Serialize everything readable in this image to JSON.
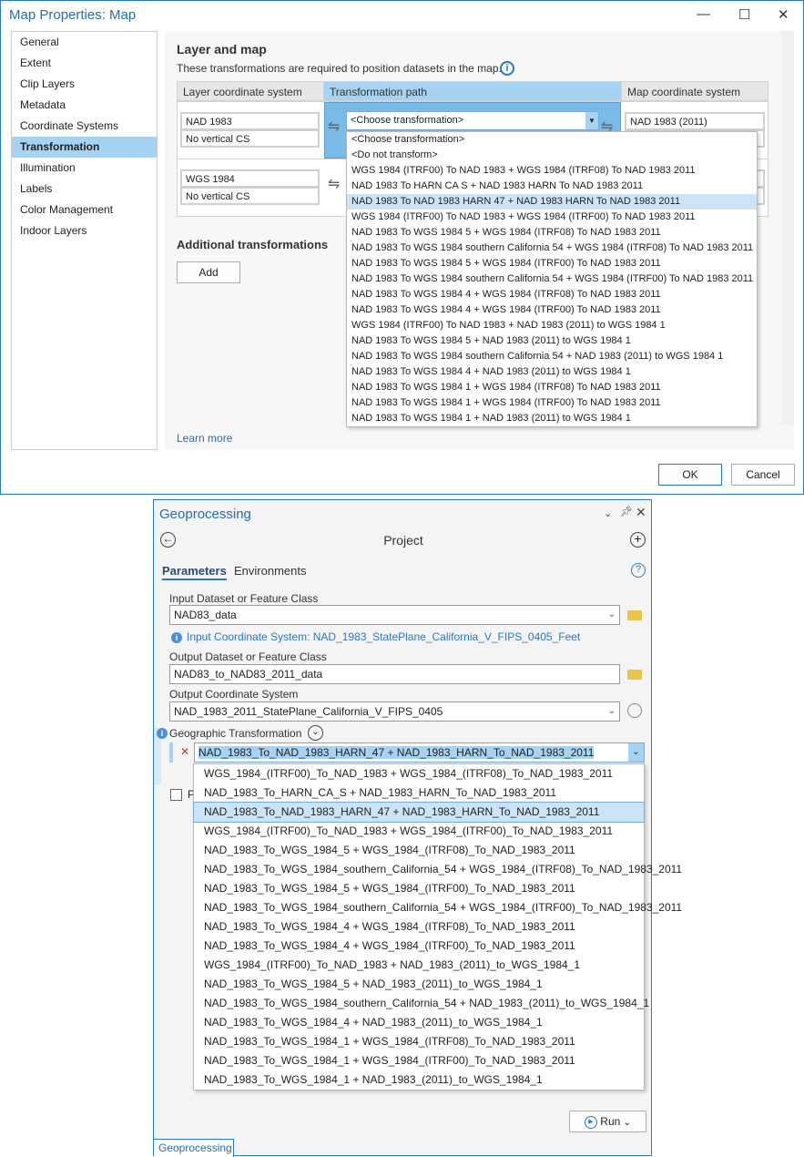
{
  "map_window": {
    "title": "Map Properties: Map",
    "controls": {
      "minimize": "—",
      "maximize": "☐",
      "close": "✕"
    },
    "sidebar": [
      "General",
      "Extent",
      "Clip Layers",
      "Metadata",
      "Coordinate Systems",
      "Transformation",
      "Illumination",
      "Labels",
      "Color Management",
      "Indoor Layers"
    ],
    "selected_sidebar": "Transformation",
    "section_title": "Layer and map",
    "description": "These transformations are required to position datasets in the map.",
    "columns": [
      "Layer coordinate system",
      "Transformation path",
      "Map coordinate system"
    ],
    "rows": [
      {
        "layer_cs": "NAD 1983",
        "layer_vcs": "No vertical CS",
        "transformation": "<Choose transformation>",
        "map_cs": "NAD 1983 (2011)"
      },
      {
        "layer_cs": "WGS 1984",
        "layer_vcs": "No vertical CS"
      }
    ],
    "dropdown_options": [
      "<Choose transformation>",
      "<Do not transform>",
      "WGS 1984 (ITRF00) To NAD 1983 + WGS 1984 (ITRF08) To NAD 1983 2011",
      "NAD 1983 To HARN CA S + NAD 1983 HARN To NAD 1983 2011",
      "NAD 1983 To NAD 1983 HARN 47 + NAD 1983 HARN To NAD 1983 2011",
      "WGS 1984 (ITRF00) To NAD 1983 + WGS 1984 (ITRF00) To NAD 1983 2011",
      "NAD 1983 To WGS 1984 5 + WGS 1984 (ITRF08) To NAD 1983 2011",
      "NAD 1983 To WGS 1984 southern California 54 + WGS 1984 (ITRF08) To NAD 1983 2011",
      "NAD 1983 To WGS 1984 5 + WGS 1984 (ITRF00) To NAD 1983 2011",
      "NAD 1983 To WGS 1984 southern California 54 + WGS 1984 (ITRF00) To NAD 1983 2011",
      "NAD 1983 To WGS 1984 4 + WGS 1984 (ITRF08) To NAD 1983 2011",
      "NAD 1983 To WGS 1984 4 + WGS 1984 (ITRF00) To NAD 1983 2011",
      "WGS 1984 (ITRF00) To NAD 1983 + NAD 1983 (2011) to WGS 1984 1",
      "NAD 1983 To WGS 1984 5 + NAD 1983 (2011) to WGS 1984 1",
      "NAD 1983 To WGS 1984 southern California 54 + NAD 1983 (2011) to WGS 1984 1",
      "NAD 1983 To WGS 1984 4 + NAD 1983 (2011) to WGS 1984 1",
      "NAD 1983 To WGS 1984 1 + WGS 1984 (ITRF08) To NAD 1983 2011",
      "NAD 1983 To WGS 1984 1 + WGS 1984 (ITRF00) To NAD 1983 2011",
      "NAD 1983 To WGS 1984 1 + NAD 1983 (2011) to WGS 1984 1"
    ],
    "highlighted_option_index": 4,
    "additional_title": "Additional transformations",
    "add_label": "Add",
    "learn_more": "Learn more",
    "ok_label": "OK",
    "cancel_label": "Cancel"
  },
  "geoprocessing": {
    "title": "Geoprocessing",
    "tool_name": "Project",
    "tabs": [
      "Parameters",
      "Environments"
    ],
    "input_label": "Input Dataset or Feature Class",
    "input_value": "NAD83_data",
    "input_info": "Input Coordinate System: NAD_1983_StatePlane_California_V_FIPS_0405_Feet",
    "output_label": "Output Dataset or Feature Class",
    "output_value": "NAD83_to_NAD83_2011_data",
    "ocs_label": "Output Coordinate System",
    "ocs_value": "NAD_1983_2011_StatePlane_California_V_FIPS_0405",
    "gt_label": "Geographic Transformation",
    "gt_value": "NAD_1983_To_NAD_1983_HARN_47 + NAD_1983_HARN_To_NAD_1983_2011",
    "gt_options": [
      "WGS_1984_(ITRF00)_To_NAD_1983 + WGS_1984_(ITRF08)_To_NAD_1983_2011",
      "NAD_1983_To_HARN_CA_S + NAD_1983_HARN_To_NAD_1983_2011",
      "NAD_1983_To_NAD_1983_HARN_47 + NAD_1983_HARN_To_NAD_1983_2011",
      "WGS_1984_(ITRF00)_To_NAD_1983 + WGS_1984_(ITRF00)_To_NAD_1983_2011",
      "NAD_1983_To_WGS_1984_5 + WGS_1984_(ITRF08)_To_NAD_1983_2011",
      "NAD_1983_To_WGS_1984_southern_California_54 + WGS_1984_(ITRF08)_To_NAD_1983_2011",
      "NAD_1983_To_WGS_1984_5 + WGS_1984_(ITRF00)_To_NAD_1983_2011",
      "NAD_1983_To_WGS_1984_southern_California_54 + WGS_1984_(ITRF00)_To_NAD_1983_2011",
      "NAD_1983_To_WGS_1984_4 + WGS_1984_(ITRF08)_To_NAD_1983_2011",
      "NAD_1983_To_WGS_1984_4 + WGS_1984_(ITRF00)_To_NAD_1983_2011",
      "WGS_1984_(ITRF00)_To_NAD_1983 + NAD_1983_(2011)_to_WGS_1984_1",
      "NAD_1983_To_WGS_1984_5 + NAD_1983_(2011)_to_WGS_1984_1",
      "NAD_1983_To_WGS_1984_southern_California_54 + NAD_1983_(2011)_to_WGS_1984_1",
      "NAD_1983_To_WGS_1984_4 + NAD_1983_(2011)_to_WGS_1984_1",
      "NAD_1983_To_WGS_1984_1 + WGS_1984_(ITRF08)_To_NAD_1983_2011",
      "NAD_1983_To_WGS_1984_1 + WGS_1984_(ITRF00)_To_NAD_1983_2011",
      "NAD_1983_To_WGS_1984_1 + NAD_1983_(2011)_to_WGS_1984_1"
    ],
    "gt_highlighted_index": 2,
    "checkbox_label_partial": "P",
    "run_label": "Run",
    "bottom_tab": "Geoprocessing",
    "accent": "#2b6cb0"
  }
}
